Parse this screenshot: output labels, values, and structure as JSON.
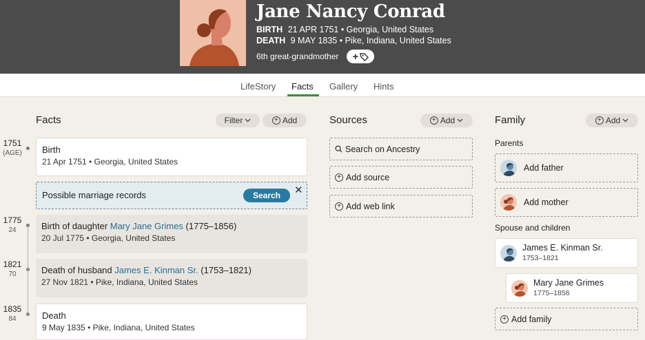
{
  "profile": {
    "name": "Jane Nancy Conrad",
    "birth_label": "BIRTH",
    "birth_value": "21 APR 1751 • Georgia, United States",
    "death_label": "DEATH",
    "death_value": "9 MAY 1835 • Pike, Indiana, United States",
    "relationship": "6th great-grandmother",
    "tag_button": "+"
  },
  "tabs": [
    {
      "label": "LifeStory"
    },
    {
      "label": "Facts"
    },
    {
      "label": "Gallery"
    },
    {
      "label": "Hints"
    }
  ],
  "facts_section": {
    "title": "Facts",
    "filter_label": "Filter",
    "add_label": "Add",
    "timeline": [
      {
        "year": "1751",
        "age": "(AGE)"
      },
      {
        "year": "1775",
        "age": "24"
      },
      {
        "year": "1821",
        "age": "70"
      },
      {
        "year": "1835",
        "age": "84"
      }
    ],
    "birth": {
      "title": "Birth",
      "detail": "21 Apr 1751 • Georgia, United States"
    },
    "hint": {
      "text": "Possible marriage records",
      "button": "Search",
      "close": "✕"
    },
    "daughter": {
      "prefix": "Birth of daughter ",
      "person": "Mary Jane Grimes",
      "suffix": " (1775–1856)",
      "detail": "20 Jul 1775 • Georgia, United States"
    },
    "husband": {
      "prefix": "Death of husband ",
      "person": "James E. Kinman Sr.",
      "suffix": " (1753–1821)",
      "detail": "27 Nov 1821 • Pike, Indiana, United States"
    },
    "death": {
      "title": "Death",
      "detail": "9 May 1835 • Pike, Indiana, United States"
    }
  },
  "sources_section": {
    "title": "Sources",
    "add_label": "Add",
    "search_ancestry": "Search on Ancestry",
    "add_source": "Add source",
    "add_web_link": "Add web link"
  },
  "family_section": {
    "title": "Family",
    "add_label": "Add",
    "parents_label": "Parents",
    "add_father": "Add father",
    "add_mother": "Add mother",
    "spouse_children_label": "Spouse and children",
    "spouse": {
      "name": "James E. Kinman Sr.",
      "years": "1753–1821"
    },
    "child": {
      "name": "Mary Jane Grimes",
      "years": "1775–1856"
    },
    "add_family": "Add family"
  },
  "colors": {
    "header_bg": "#4b4b4b",
    "accent_green": "#3b8d3b",
    "link_blue": "#2a6f94",
    "button_blue": "#2a7aa0"
  },
  "icons": [
    "female-portrait-icon",
    "tag-icon",
    "chevron-down-icon",
    "add-circle-icon",
    "search-icon",
    "close-icon",
    "male-avatar-icon",
    "female-avatar-icon"
  ]
}
